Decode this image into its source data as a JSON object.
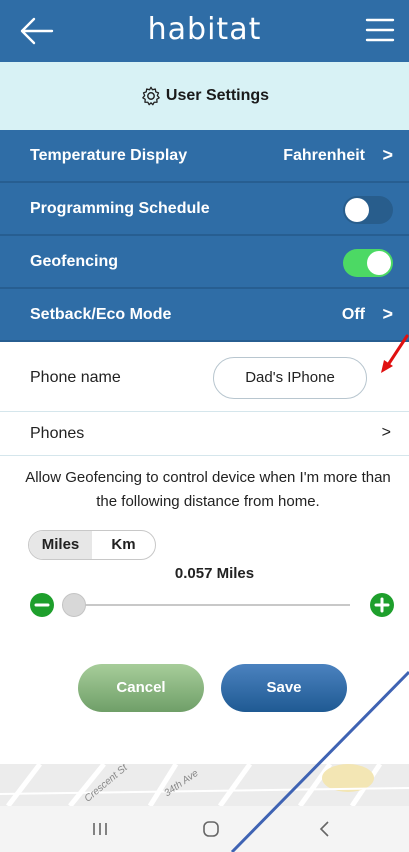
{
  "app": {
    "brand": "habitat"
  },
  "header": {
    "title": "User Settings"
  },
  "rows": {
    "temperature": {
      "label": "Temperature Display",
      "value": "Fahrenheit",
      "chevron": ">"
    },
    "schedule": {
      "label": "Programming Schedule",
      "enabled": false
    },
    "geofencing": {
      "label": "Geofencing",
      "enabled": true
    },
    "setback": {
      "label": "Setback/Eco Mode",
      "value": "Off",
      "chevron": ">"
    },
    "phone_name": {
      "label": "Phone name",
      "value": "Dad's IPhone"
    },
    "phones": {
      "label": "Phones",
      "chevron": ">"
    }
  },
  "geofence": {
    "description": "Allow Geofencing to control device when I'm more than the following distance from home.",
    "units": [
      "Miles",
      "Km"
    ],
    "selected_unit": "Miles",
    "distance": "0.057 Miles",
    "slider_fraction": 0.0
  },
  "buttons": {
    "cancel": "Cancel",
    "save": "Save"
  },
  "map": {
    "labels": [
      "Crescent St",
      "34th Ave"
    ]
  },
  "icons": {
    "back": "back-arrow-icon",
    "menu": "hamburger-menu-icon",
    "settings": "gear-icon",
    "minus": "minus-circle-icon",
    "plus": "plus-circle-icon"
  },
  "colors": {
    "primary": "#2f6da6",
    "header_bg": "#d8f2f5",
    "toggle_on": "#4cd964",
    "cancel": "#8ab87f",
    "save": "#2b67a5",
    "slider_buttons": "#1e9f2c"
  }
}
